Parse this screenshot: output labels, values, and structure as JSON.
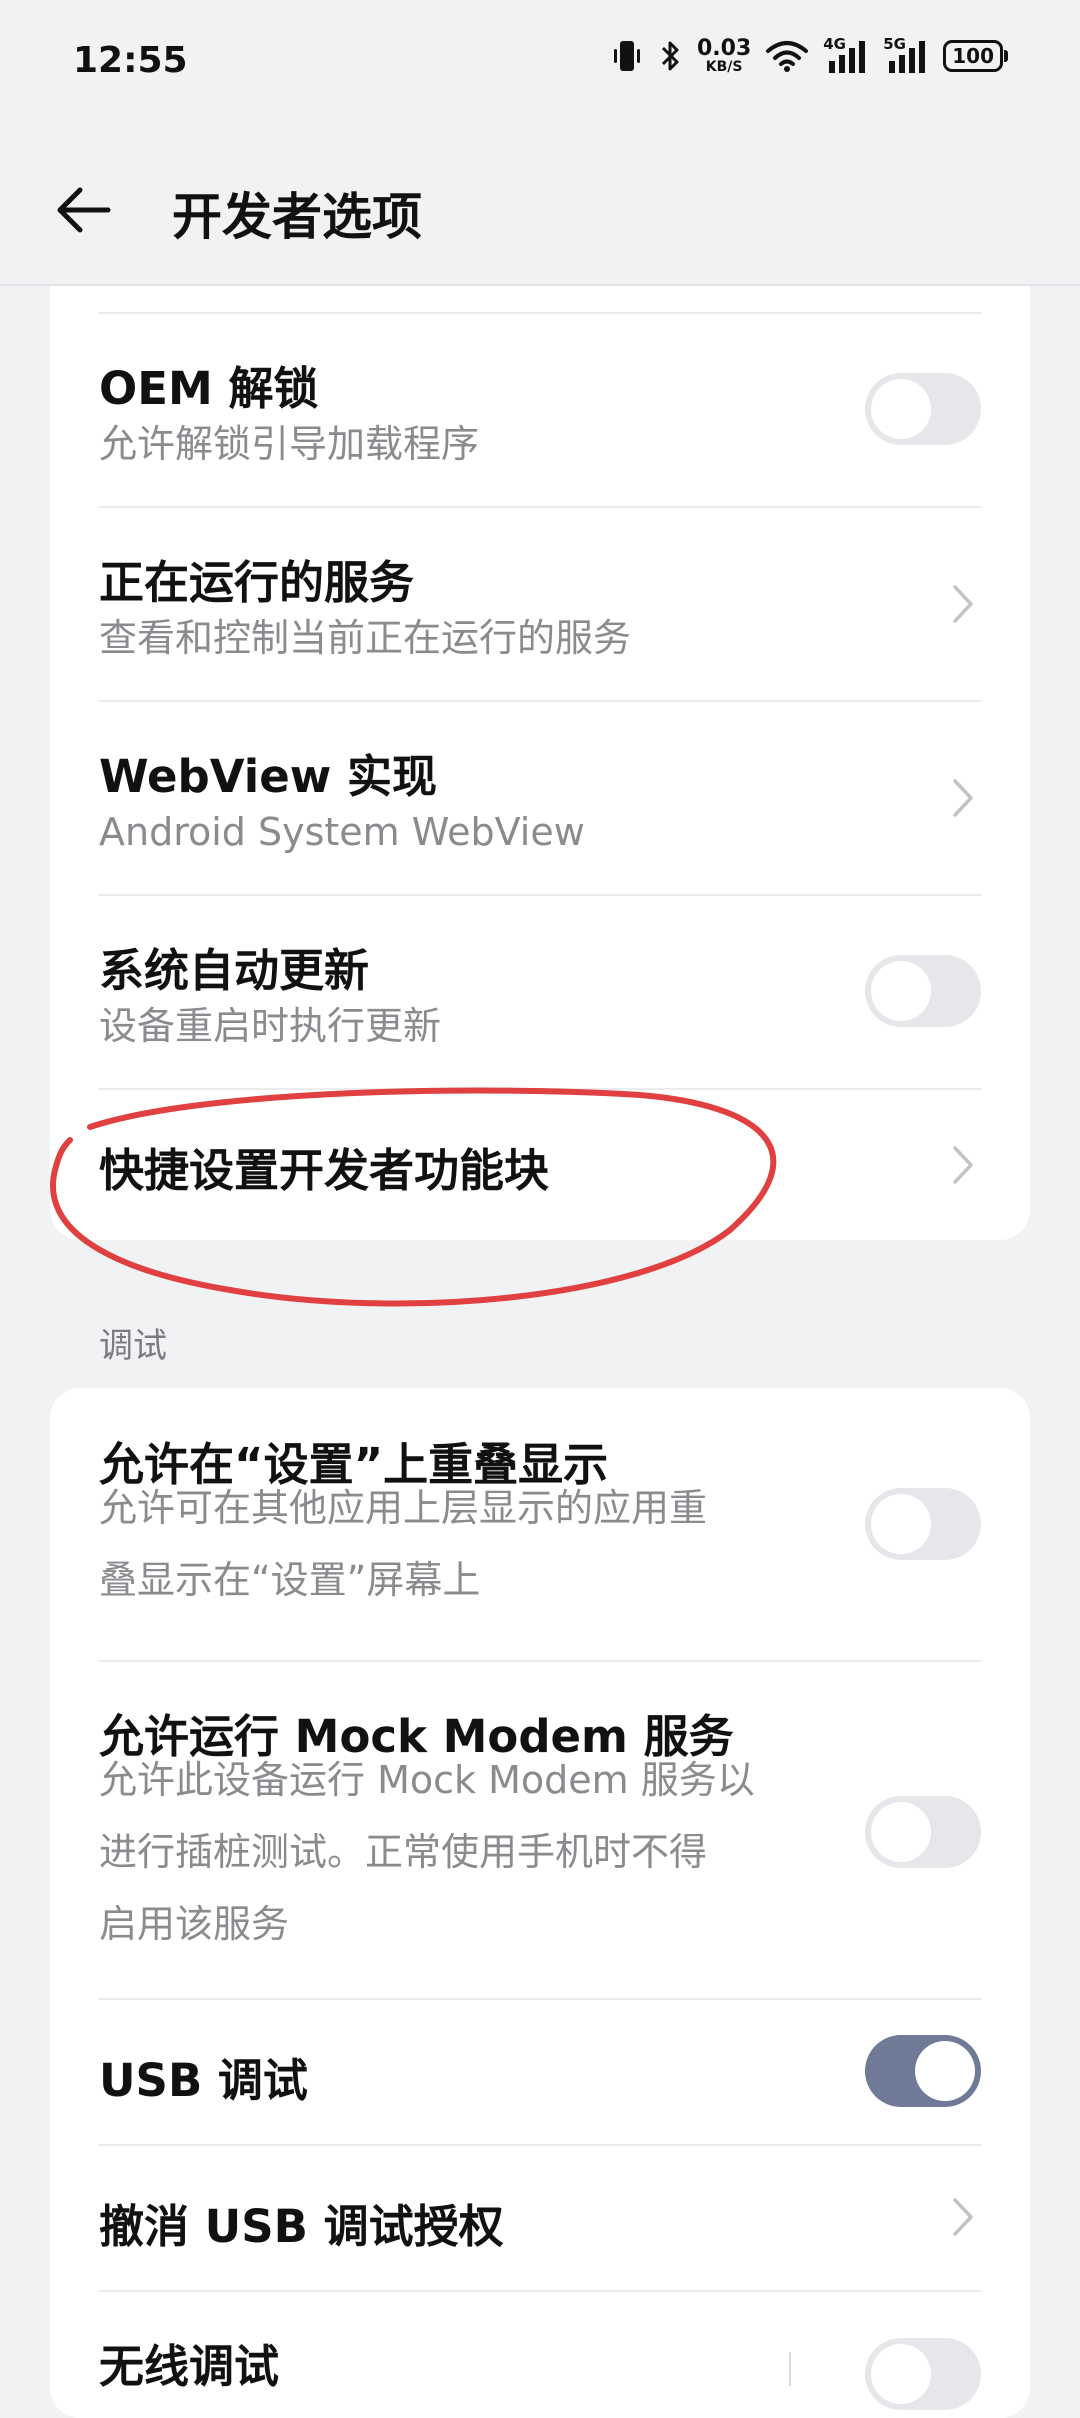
{
  "status_bar": {
    "time": "12:55",
    "net_speed_value": "0.03",
    "net_speed_unit": "KB/S",
    "signal_1_label": "4G",
    "signal_2_label": "5G",
    "battery": "100",
    "icons": [
      "vibrate-icon",
      "bluetooth-icon",
      "wifi-icon",
      "signal-icon",
      "battery-icon"
    ]
  },
  "app_bar": {
    "title": "开发者选项"
  },
  "card1": {
    "items": [
      {
        "title": "OEM 解锁",
        "subtitle": "允许解锁引导加载程序",
        "control": "toggle",
        "on": false
      },
      {
        "title": "正在运行的服务",
        "subtitle": "查看和控制当前正在运行的服务",
        "control": "chevron"
      },
      {
        "title": "WebView 实现",
        "subtitle": "Android System WebView",
        "control": "chevron"
      },
      {
        "title": "系统自动更新",
        "subtitle": "设备重启时执行更新",
        "control": "toggle",
        "on": false
      },
      {
        "title": "快捷设置开发者功能块",
        "control": "chevron"
      }
    ]
  },
  "section_debug": {
    "header": "调试"
  },
  "card2": {
    "items": [
      {
        "title": "允许在“设置”上重叠显示",
        "subtitle_lines": [
          "允许可在其他应用上层显示的应用重",
          "叠显示在“设置”屏幕上"
        ],
        "control": "toggle",
        "on": false
      },
      {
        "title": "允许运行 Mock Modem 服务",
        "subtitle_lines": [
          "允许此设备运行 Mock Modem 服务以",
          "进行插桩测试。正常使用手机时不得",
          "启用该服务"
        ],
        "control": "toggle",
        "on": false
      },
      {
        "title": "USB 调试",
        "control": "toggle",
        "on": true
      },
      {
        "title": "撤消 USB 调试授权",
        "control": "chevron"
      },
      {
        "title": "无线调试",
        "control": "toggle",
        "on": false
      }
    ]
  },
  "colors": {
    "background": "#f1f2f4",
    "toggle_on": "#6e7a96",
    "toggle_off": "#e6e7ea",
    "annotation_red": "#e0403f"
  }
}
